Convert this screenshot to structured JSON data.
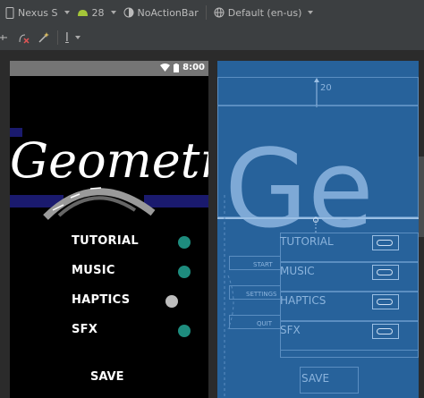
{
  "toolbar": {
    "device": "Nexus S",
    "api_level": "28",
    "theme": "NoActionBar",
    "locale": "Default (en-us)"
  },
  "toolbar2": {
    "text_tool_label": "I"
  },
  "phone": {
    "status_time": "8:00",
    "logo_text": "Geometry",
    "menu": [
      {
        "label": "TUTORIAL",
        "enabled": true
      },
      {
        "label": "MUSIC",
        "enabled": true
      },
      {
        "label": "HAPTICS",
        "enabled": false
      },
      {
        "label": "SFX",
        "enabled": true
      }
    ],
    "save_label": "SAVE"
  },
  "blueprint": {
    "margin_value": "20",
    "logo_fragment": "Ge",
    "buttons": [
      "START",
      "SETTINGS",
      "QUIT"
    ],
    "menu": [
      "TUTORIAL",
      "MUSIC",
      "HAPTICS",
      "SFX"
    ],
    "save_label": "SAVE"
  },
  "colors": {
    "switch_on": "#1e8c7e",
    "switch_off": "#bdbdbd",
    "blueprint_bg": "#27629b",
    "toolbar_bg": "#3c3f41"
  }
}
